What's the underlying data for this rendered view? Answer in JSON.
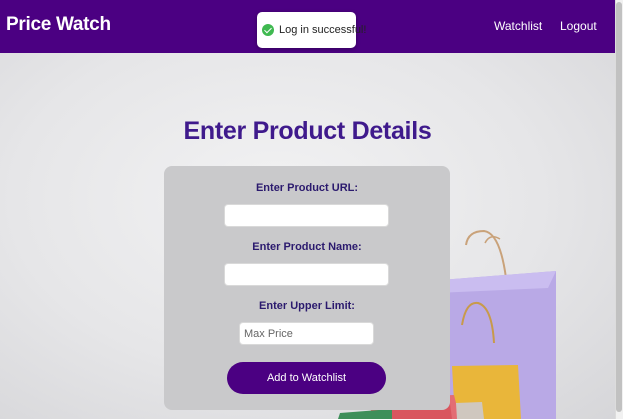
{
  "navbar": {
    "brand": "Price Watch",
    "links": {
      "watchlist": "Watchlist",
      "logout": "Logout"
    },
    "background_color": "#4b0082"
  },
  "toast": {
    "message": "Log in successful!",
    "icon": "check-circle-icon",
    "icon_color": "#3fb950"
  },
  "main": {
    "title": "Enter Product Details",
    "form": {
      "url_label": "Enter Product URL:",
      "url_value": "",
      "name_label": "Enter Product Name:",
      "name_value": "",
      "limit_label": "Enter Upper Limit:",
      "limit_placeholder": "Max Price",
      "submit_label": "Add to Watchlist"
    }
  },
  "colors": {
    "accent": "#4b0082",
    "title": "#3f1a8c"
  }
}
